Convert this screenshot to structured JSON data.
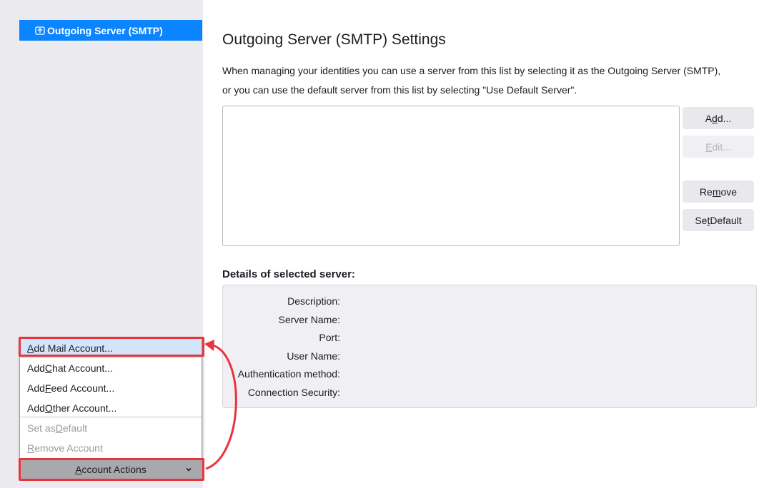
{
  "sidebar": {
    "selected_item": "Outgoing Server (SMTP)",
    "selected_icon": "server-icon"
  },
  "main": {
    "title": "Outgoing Server (SMTP) Settings",
    "desc_line1": "When managing your identities you can use a server from this list by selecting it as the Outgoing Server (SMTP),",
    "desc_line2": "or you can use the default server from this list by selecting \"Use Default Server\".",
    "buttons": {
      "add": {
        "pre": "A",
        "key": "d",
        "post": "d..."
      },
      "edit": {
        "pre": "",
        "key": "E",
        "post": "dit..."
      },
      "remove": {
        "pre": "Re",
        "key": "m",
        "post": "ove"
      },
      "set_default": {
        "pre": "Se",
        "key": "t",
        "post": " Default"
      }
    },
    "details_heading": "Details of selected server:",
    "details_labels": {
      "description": "Description:",
      "server_name": "Server Name:",
      "port": "Port:",
      "user_name": "User Name:",
      "auth_method": "Authentication method:",
      "connection_security": "Connection Security:"
    }
  },
  "menu": {
    "add_mail": {
      "pre": "",
      "key": "A",
      "post": "dd Mail Account..."
    },
    "add_chat": {
      "pre": "Add ",
      "key": "C",
      "post": "hat Account..."
    },
    "add_feed": {
      "pre": "Add ",
      "key": "F",
      "post": "eed Account..."
    },
    "add_other": {
      "pre": "Add ",
      "key": "O",
      "post": "ther Account..."
    },
    "set_default": {
      "pre": "Set as ",
      "key": "D",
      "post": "efault"
    },
    "remove": {
      "pre": "",
      "key": "R",
      "post": "emove Account"
    }
  },
  "account_actions": {
    "pre": "",
    "key": "A",
    "post": "ccount Actions",
    "chevron_icon": "chevron-down-icon"
  },
  "colors": {
    "accent": "#0a84ff",
    "annotation": "#e8343c",
    "menu_highlight": "#d3e5fb"
  }
}
